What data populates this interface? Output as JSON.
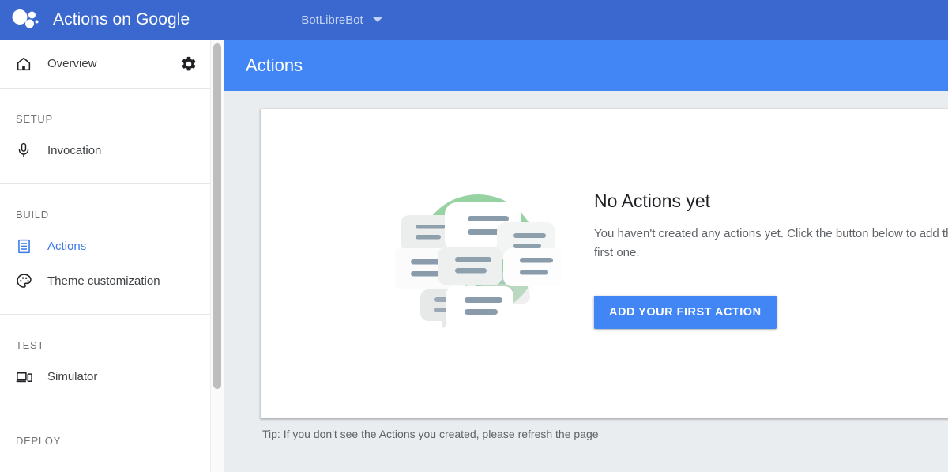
{
  "topbar": {
    "logo_icon": "google-assistant-logo",
    "brand": "Actions on Google",
    "project_name": "BotLibreBot",
    "caret_icon": "chevron-down-icon"
  },
  "sidebar": {
    "overview": {
      "icon": "home-icon",
      "label": "Overview",
      "settings_icon": "gear-icon"
    },
    "groups": [
      {
        "title": "SETUP",
        "items": [
          {
            "icon": "microphone-icon",
            "label": "Invocation",
            "active": false
          }
        ]
      },
      {
        "title": "BUILD",
        "items": [
          {
            "icon": "list-document-icon",
            "label": "Actions",
            "active": true
          },
          {
            "icon": "palette-icon",
            "label": "Theme customization",
            "active": false
          }
        ]
      },
      {
        "title": "TEST",
        "items": [
          {
            "icon": "devices-icon",
            "label": "Simulator",
            "active": false
          }
        ]
      },
      {
        "title": "DEPLOY",
        "items": []
      }
    ]
  },
  "scrollbar": {
    "name": "sidebar-scrollbar"
  },
  "main": {
    "page_title": "Actions",
    "empty_state": {
      "illustration": "speech-bubbles-illustration",
      "title": "No Actions yet",
      "body": "You haven't created any actions yet. Click the button below to add the first one.",
      "cta_label": "ADD YOUR FIRST ACTION"
    },
    "tip": "Tip: If you don't see the Actions you created, please refresh the page"
  },
  "colors": {
    "topbar_blue": "#3b68cf",
    "header_blue": "#4285f4",
    "accent_blue": "#3b78e7",
    "page_bg": "#eaedef",
    "illustration_green": "#96d2a2",
    "bubble_line": "#9aa9b5"
  }
}
